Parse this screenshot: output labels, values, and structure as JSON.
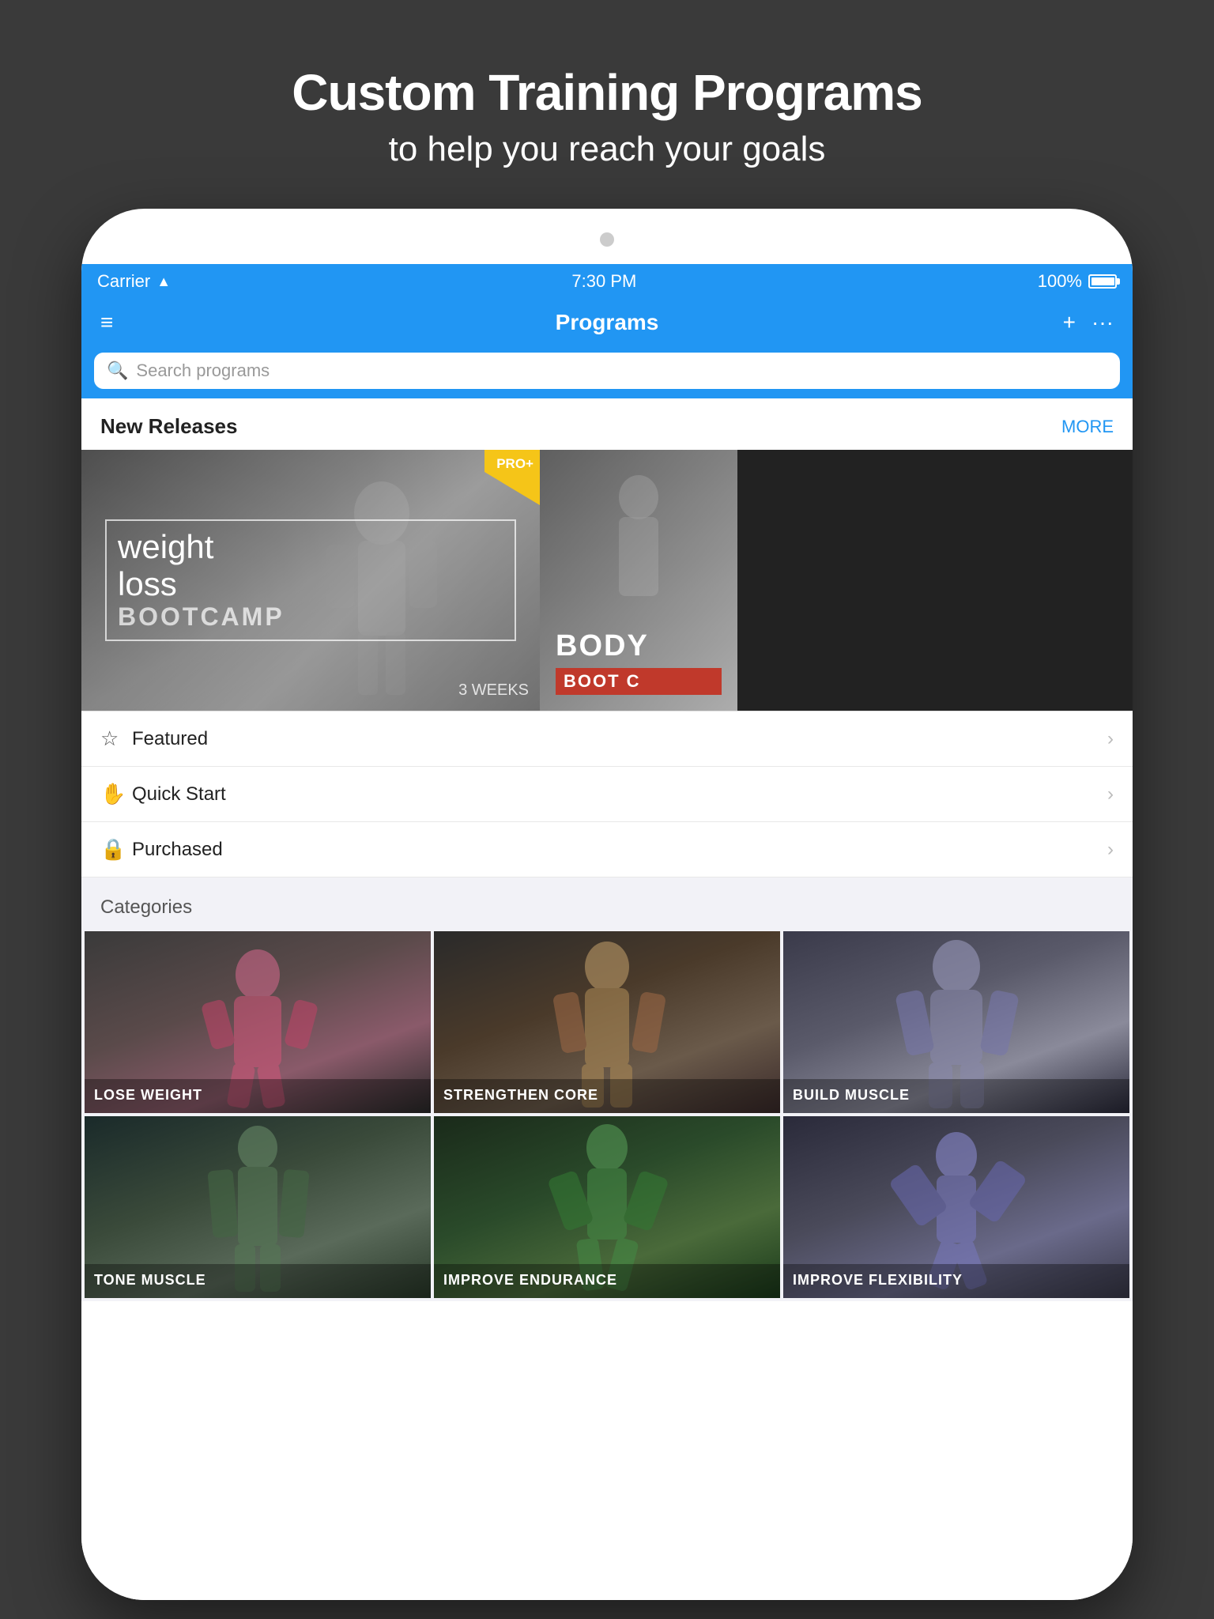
{
  "page": {
    "header": {
      "title": "Custom Training Programs",
      "subtitle": "to help you reach your goals"
    }
  },
  "status_bar": {
    "carrier": "Carrier",
    "time": "7:30 PM",
    "battery": "100%"
  },
  "nav": {
    "title": "Programs",
    "menu_icon": "≡",
    "add_icon": "+",
    "more_icon": "···"
  },
  "search": {
    "placeholder": "Search programs"
  },
  "new_releases": {
    "label": "New Releases",
    "more": "MORE",
    "cards": [
      {
        "title_line1": "weight",
        "title_line2": "loss",
        "title_line3": "BOOTCAMP",
        "badge": "PRO+",
        "duration": "3 WEEKS"
      },
      {
        "title": "BODY",
        "subtitle": "BOOT C"
      }
    ]
  },
  "list_items": [
    {
      "icon": "☆",
      "label": "Featured"
    },
    {
      "icon": "✋",
      "label": "Quick Start"
    },
    {
      "icon": "🔒",
      "label": "Purchased"
    }
  ],
  "categories": {
    "title": "Categories",
    "items": [
      {
        "label": "LOSE WEIGHT",
        "bg_class": "cat-lose-weight"
      },
      {
        "label": "STRENGTHEN CORE",
        "bg_class": "cat-strengthen"
      },
      {
        "label": "BUILD MUSCLE",
        "bg_class": "cat-build"
      },
      {
        "label": "TONE MUSCLE",
        "bg_class": "cat-tone"
      },
      {
        "label": "IMPROVE ENDURANCE",
        "bg_class": "cat-endurance"
      },
      {
        "label": "IMPROVE FLEXIBILITY",
        "bg_class": "cat-flexibility"
      }
    ]
  }
}
